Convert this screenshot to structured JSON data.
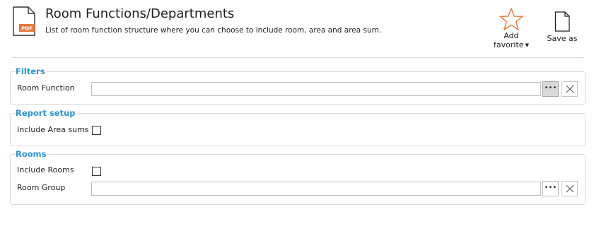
{
  "header": {
    "title": "Room Functions/Departments",
    "subtitle": "List of room function structure where you can choose to include room, area and area sum.",
    "file_icon_text": "PDF"
  },
  "toolbar": {
    "add_favorite_line1": "Add",
    "add_favorite_line2": "favorite",
    "save_as_label": "Save as"
  },
  "filters": {
    "title": "Filters",
    "room_function_label": "Room Function",
    "room_function_value": ""
  },
  "report_setup": {
    "title": "Report setup",
    "include_area_sums_label": "Include Area sums",
    "include_area_sums_checked": false
  },
  "rooms": {
    "title": "Rooms",
    "include_rooms_label": "Include Rooms",
    "include_rooms_checked": false,
    "room_group_label": "Room Group",
    "room_group_value": ""
  },
  "buttons": {
    "ellipsis_label": "•••"
  },
  "colors": {
    "accent": "#2b93d6",
    "pdf_badge": "#e8773c",
    "favorite_star": "#e8773c"
  }
}
